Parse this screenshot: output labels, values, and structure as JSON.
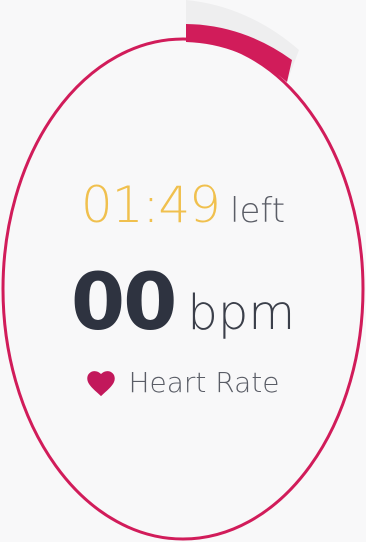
{
  "colors": {
    "background": "#f8f8f9",
    "ring": "#d11c5a",
    "progress_track": "#eeeeef",
    "timer": "#f0c04e",
    "timer_suffix": "#5a5d66",
    "bpm_value": "#2e3340",
    "bpm_unit": "#3b3f4a",
    "heart": "#c2185b",
    "label": "#5a5d66"
  },
  "timer": {
    "value": "01:49",
    "suffix": "left"
  },
  "reading": {
    "value": "00",
    "unit": "bpm"
  },
  "label": {
    "icon": "heart-icon",
    "text": "Heart Rate"
  },
  "progress": {
    "elapsed_fraction": 0.05
  }
}
